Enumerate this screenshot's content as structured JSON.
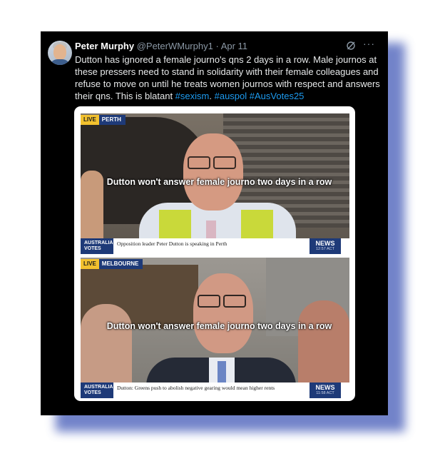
{
  "tweet": {
    "name": "Peter Murphy",
    "handle": "@PeterWMurphy1",
    "separator": "·",
    "date": "Apr 11",
    "more": "···",
    "text_plain": "Dutton has ignored a female journo's qns 2 days in a row. Male journos at these pressers need to stand in solidarity with their female colleagues and refuse to move on until he treats women journos with respect and answers their qns. This is blatant ",
    "hashtags": [
      "#sexism",
      "#auspol",
      "#AusVotes25"
    ],
    "hashtag_suffix": "."
  },
  "frames": [
    {
      "live": "LIVE",
      "location": "PERTH",
      "caption": "Dutton won't answer female journo two days in a row",
      "lower_tag": [
        "AUSTRALIA",
        "VOTES"
      ],
      "lower_text": "Opposition leader Peter Dutton is speaking in Perth",
      "brand": "NEWS",
      "time": "12:57 ACT"
    },
    {
      "live": "LIVE",
      "location": "MELBOURNE",
      "caption": "Dutton won't answer female journo two days in a row",
      "lower_tag": [
        "AUSTRALIA",
        "VOTES"
      ],
      "lower_text": "Dutton: Greens push to abolish negative gearing would mean higher rents",
      "brand": "NEWS",
      "time": "11:58 ACT"
    }
  ],
  "icons": [
    "avatar",
    "grok-icon",
    "more-icon",
    "abc-news-logo"
  ],
  "colors": {
    "background": "#000000",
    "link": "#1d9bf0",
    "muted": "#8b98a5",
    "shadow": "#5a6ec0"
  }
}
